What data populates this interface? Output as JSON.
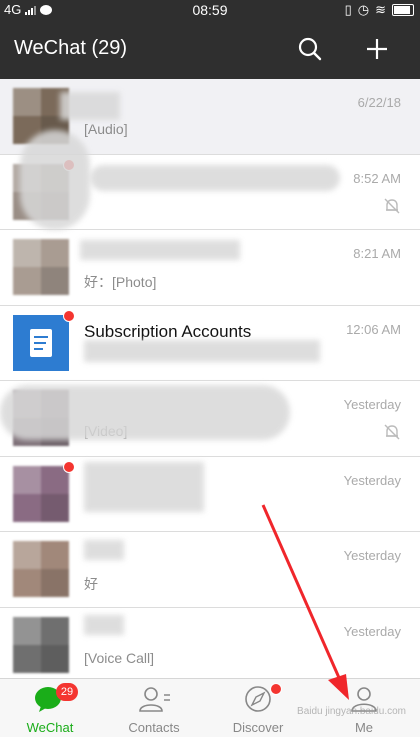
{
  "status": {
    "network": "4G",
    "time": "08:59"
  },
  "app": {
    "title": "WeChat (29)"
  },
  "chats": [
    {
      "name": "",
      "preview": "[Audio]",
      "time": "6/22/18",
      "muted": false,
      "unread_dot": false,
      "avatar_color": "#7b6a5a"
    },
    {
      "name": "",
      "preview": "",
      "time": "8:52 AM",
      "muted": true,
      "unread_dot": true,
      "avatar_color": "#9a8e86"
    },
    {
      "name": "",
      "preview": "好：[Photo]",
      "time": "8:21 AM",
      "muted": false,
      "unread_dot": false,
      "avatar_color": "#a99c92"
    },
    {
      "name": "Subscription Accounts",
      "preview": "",
      "time": "12:06 AM",
      "muted": false,
      "unread_dot": true,
      "avatar_color": "#2d7cd1"
    },
    {
      "name": "",
      "preview": "[Video]",
      "time": "Yesterday",
      "muted": true,
      "unread_dot": false,
      "avatar_color": "#7d6f77"
    },
    {
      "name": "",
      "preview": "",
      "time": "Yesterday",
      "muted": false,
      "unread_dot": true,
      "avatar_color": "#8a6b83"
    },
    {
      "name": "",
      "preview": "好",
      "time": "Yesterday",
      "muted": false,
      "unread_dot": false,
      "avatar_color": "#a1887a"
    },
    {
      "name": "",
      "preview": "[Voice Call]",
      "time": "Yesterday",
      "muted": false,
      "unread_dot": false,
      "avatar_color": "#6f6f6f"
    }
  ],
  "tabs": [
    {
      "label": "WeChat",
      "active": true,
      "badge": "29"
    },
    {
      "label": "Contacts",
      "active": false
    },
    {
      "label": "Discover",
      "active": false,
      "dot": true
    },
    {
      "label": "Me",
      "active": false
    }
  ],
  "watermark": "Baidu jingyan.baidu.com",
  "colors": {
    "accent": "#1aad19",
    "header": "#2f2f2f",
    "badge": "#f43530",
    "annotation_arrow": "#f0262b"
  }
}
